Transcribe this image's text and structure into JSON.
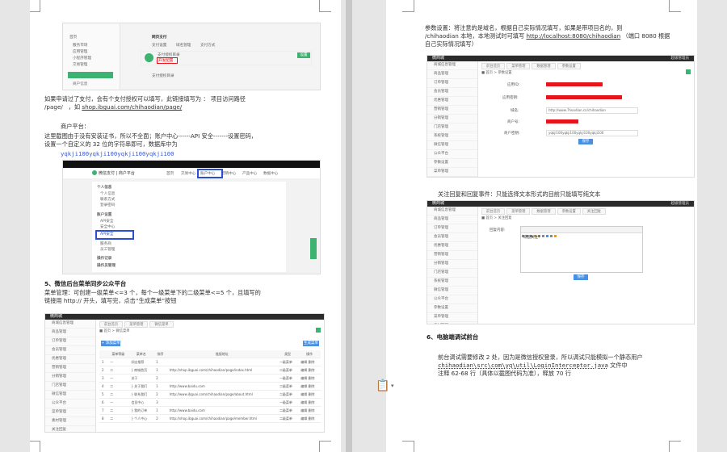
{
  "left_page": {
    "shot1": {
      "sidebar_title": "首页",
      "sidebar_items": [
        "服务市场",
        "应用管理",
        "小程序管理",
        "交易管理"
      ],
      "tab_label": "网页支付",
      "main_tabs": [
        "支付设置",
        "域名管理",
        "支付方式"
      ],
      "card_line1": "支付授权目录",
      "card_line2": "开发配置",
      "button_label": "设置",
      "footer_item": "商户信息",
      "note_line": "支付授权目录"
    },
    "para1": "如果申请过了支付，会有个支付授权可以填写，此链接填写为 ： 项目访问路径/page/ ，如 shop.ibguai.com/chihaodian/page/",
    "para1_line1": "如果申请过了支付，会有个支付授权可以填写，此链接填写为 ： 项目访问路径",
    "para1_line2a": "/page/",
    "para1_line2b": "，如",
    "para1_link": "shop.ibguai.com/chihaodian/page/",
    "heading_merchant": "商户平台：",
    "para2_line1": "这里截图由于没有安装证书，所以不全面；账户中心------API 安全-------设置密码，",
    "para2_line2": "设置一个自定义的 32 位的字符串即可，数据库中为",
    "key_value": "yqkji100yqkji100yqkji100yqkji100",
    "shot2": {
      "brand": "微信支付 | 商户平台",
      "nav": [
        "首页",
        "交易中心",
        "账户中心",
        "营销中心",
        "产品中心",
        "数据中心"
      ],
      "side_groups": [
        "个人信息",
        "账户设置",
        "API安全",
        "操作记录",
        "操作员管理"
      ],
      "side_items": [
        "个人信息",
        "联系方式",
        "登录密码",
        "API安全",
        "安全中心",
        "服务商",
        "员工管理"
      ]
    },
    "heading_menu": "5、微信后台菜单同步公众平台",
    "para3_line1": "菜单管理：可创建一级菜单<=3 个，每个一级菜单下的二级菜单<=5 个，且填写的",
    "para3_line2": "链接用 http:// 开头，填写完，点击“生成菜单”按钮",
    "shot3": {
      "brand": "微商城",
      "tabs": [
        "前台首页",
        "菜单管理",
        "微信菜单"
      ],
      "crumb": "■ 首页 > 微信菜单",
      "add_button": "+ 添加菜单",
      "gen_button": "生成菜单",
      "columns": [
        "",
        "菜单等级",
        "菜单名",
        "排序",
        "链接地址",
        "类型",
        "操作"
      ],
      "rows": [
        [
          "1",
          "一",
          "好店推荐",
          "1",
          "",
          "一级菜单",
          "编辑 删除"
        ],
        [
          "2",
          "二",
          "├ 商城首页",
          "1",
          "http://shop.ibguai.com/chihaodian/page/index.html",
          "二级菜单",
          "编辑 删除"
        ],
        [
          "3",
          "一",
          "关于",
          "2",
          "",
          "一级菜单",
          "编辑 删除"
        ],
        [
          "4",
          "二",
          "├ 关于我们",
          "1",
          "http://www.baidu.com",
          "二级菜单",
          "编辑 删除"
        ],
        [
          "5",
          "二",
          "├ 联系我们",
          "2",
          "http://www.ibguai.com/chihaodian/page/about.html",
          "二级菜单",
          "编辑 删除"
        ],
        [
          "6",
          "一",
          "会员中心",
          "3",
          "",
          "一级菜单",
          "编辑 删除"
        ],
        [
          "7",
          "二",
          "├ 我的订单",
          "1",
          "http://www.baidu.com",
          "二级菜单",
          "编辑 删除"
        ],
        [
          "8",
          "二",
          "├ 个人中心",
          "2",
          "http://shop.ibguai.com/chihaodian/page/member.html",
          "二级菜单",
          "编辑 删除"
        ]
      ],
      "side_items": [
        "商城信息管理",
        "商品管理",
        "订单管理",
        "会员管理",
        "优惠管理",
        "营销管理",
        "分销管理",
        "门店管理",
        "微信管理",
        "公众平台",
        "菜单管理",
        "素材管理",
        "关注回复",
        "关键词",
        "消息管理"
      ]
    }
  },
  "right_page": {
    "para1_line1": "参数设置：将注意的是域名，根据自己实际情况填写，如果是带项目名的，则",
    "para1_line2a": "/chihaodian",
    "para1_line2b": " 本地，本地测试时可填写 ",
    "para1_link": "http://localhost:8080/chihaodian",
    "para1_line2c": " （端口 8080 根据",
    "para1_line3": "自己实际情况填写）",
    "shot4": {
      "brand": "微商城",
      "user": "超级管理员",
      "tabs": [
        "前台首页",
        "菜单管理",
        "数据管理",
        "参数设置"
      ],
      "crumb": "■ 首页 > 参数设置",
      "fields": [
        "应用ID:",
        "应用密钥:",
        "域名:",
        "商户号:",
        "商户密钥:"
      ],
      "domain_value": "http://www.7hoodian.cn/chihaodian",
      "key_value": "yqkji100yqkji100yqkji100yqkji100",
      "save_button": "保存",
      "side_items": [
        "商城信息管理",
        "商品管理",
        "订单管理",
        "会员管理",
        "优惠管理",
        "营销管理",
        "分销管理",
        "门店管理",
        "系统管理",
        "微信管理",
        "公众平台",
        "参数设置",
        "菜单管理",
        "素材管理",
        "关注回复",
        "关键词"
      ]
    },
    "para2": "关注回复和回复事件：只能选择文本形式的目前只能填写纯文本",
    "shot5": {
      "brand": "微商城",
      "user": "超级管理员",
      "tabs": [
        "前台首页",
        "菜单管理",
        "数据管理",
        "参数设置",
        "关注回复"
      ],
      "crumb": "■ 首页 > 关注回复",
      "label": "回复内容:",
      "editor_text": "欢迎关注！",
      "save_button": "保存",
      "side_items": [
        "商城信息管理",
        "商品管理",
        "订单管理",
        "会员管理",
        "优惠管理",
        "营销管理",
        "分销管理",
        "门店管理",
        "系统管理",
        "微信管理",
        "公众平台",
        "参数设置",
        "菜单管理",
        "素材管理",
        "关注回复"
      ]
    },
    "heading6": "6、电脑端调试前台",
    "para3_line1": "前台调试需要修改 2 处，因为是微信授权登录，所以调试只能模拟一个静态用户",
    "para3_line2a": "chihaodian\\src\\com\\yq\\util\\LoginInterceptor.java",
    "para3_line2b": "    文件中",
    "para3_line3": "注释  62-68 行（具体以截图代码为准），释放  70 行"
  },
  "colors": {
    "red_bar": "#e8141b",
    "link_blue": "#3b5bd6",
    "select_box": "#2a4fd6",
    "green": "#3cb371"
  }
}
